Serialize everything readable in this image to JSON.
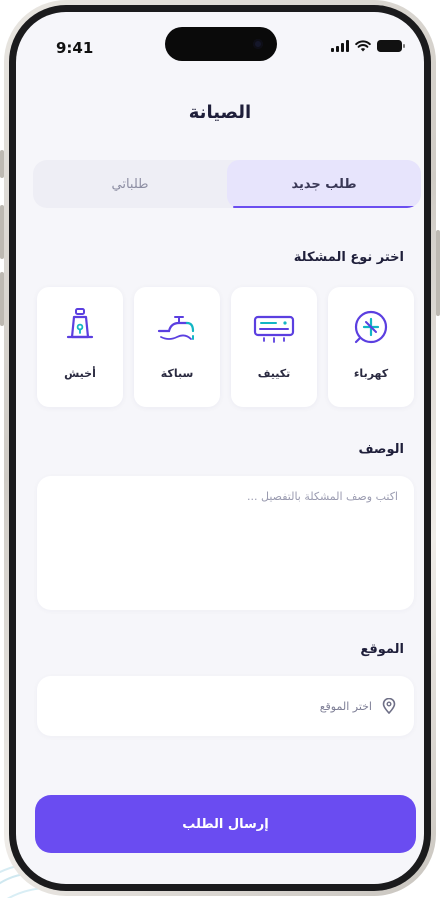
{
  "status_bar": {
    "time": "9:41"
  },
  "header": {
    "title": "الصيانة"
  },
  "tabs": [
    {
      "label": "طلب جديد",
      "active": true
    },
    {
      "label": "طلباتي",
      "active": false
    }
  ],
  "problem_section": {
    "label": "اختر نوع المشكلة",
    "types": [
      {
        "label": "كهرباء",
        "icon": "electric-plug-icon"
      },
      {
        "label": "تكييف",
        "icon": "air-conditioner-icon"
      },
      {
        "label": "سباكة",
        "icon": "faucet-icon"
      },
      {
        "label": "أخيش",
        "icon": "bell-icon"
      }
    ]
  },
  "description": {
    "label": "الوصف",
    "placeholder": "اكتب وصف المشكلة بالتفصيل ..."
  },
  "location": {
    "label": "الموقع",
    "placeholder": "اختر الموقع",
    "icon": "location-pin-icon"
  },
  "submit": {
    "label": "إرسال الطلب"
  },
  "colors": {
    "accent": "#6a4cf1",
    "accent_light": "#e7e4fc",
    "icon_stroke": "#5b3fe0",
    "icon_teal": "#12b6c4",
    "background": "#f6f6fa",
    "title": "#1f1f3a"
  }
}
